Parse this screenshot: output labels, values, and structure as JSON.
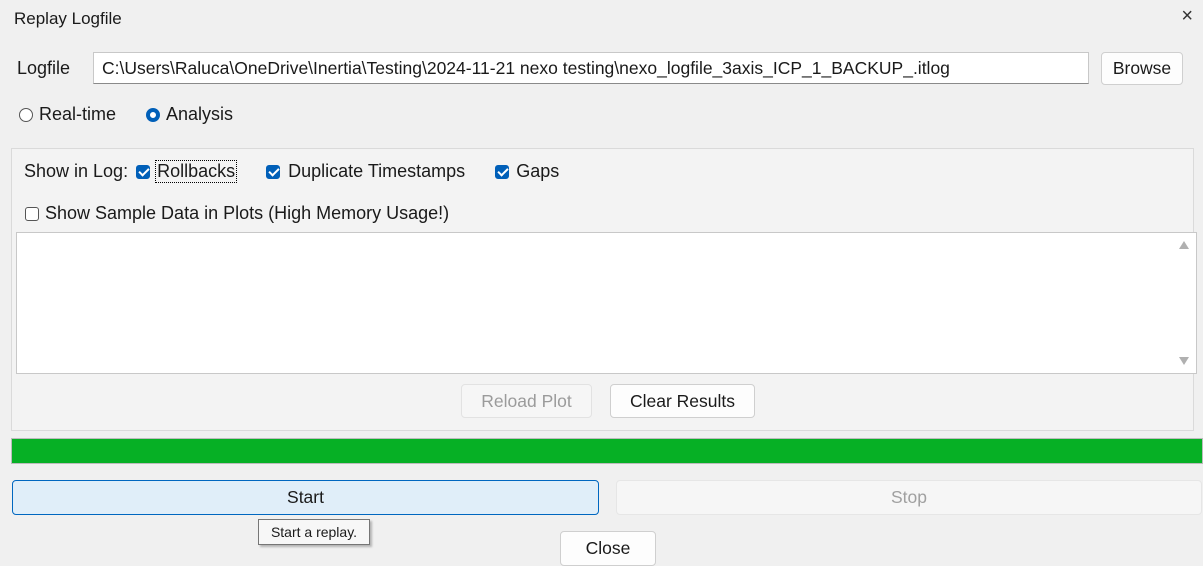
{
  "window": {
    "title": "Replay Logfile",
    "close_glyph": "×"
  },
  "file": {
    "label": "Logfile",
    "path": "C:\\Users\\Raluca\\OneDrive\\Inertia\\Testing\\2024-11-21 nexo testing\\nexo_logfile_3axis_ICP_1_BACKUP_.itlog",
    "browse_label": "Browse"
  },
  "mode": {
    "realtime_label": "Real-time",
    "realtime_selected": false,
    "analysis_label": "Analysis",
    "analysis_selected": true
  },
  "log_options": {
    "show_in_log_label": "Show in Log:",
    "rollbacks_label": "Rollbacks",
    "rollbacks_checked": true,
    "duplicate_timestamps_label": "Duplicate Timestamps",
    "duplicate_timestamps_checked": true,
    "gaps_label": "Gaps",
    "gaps_checked": true,
    "sample_data_label": "Show Sample Data in Plots (High Memory Usage!)",
    "sample_data_checked": false
  },
  "results": {
    "reload_label": "Reload Plot",
    "clear_label": "Clear Results"
  },
  "progress": {
    "value": 1.0,
    "color": "#06b025"
  },
  "controls": {
    "start_label": "Start",
    "stop_label": "Stop",
    "start_tooltip": "Start a replay.",
    "close_label": "Close"
  },
  "colors": {
    "accent": "#005fb8"
  }
}
